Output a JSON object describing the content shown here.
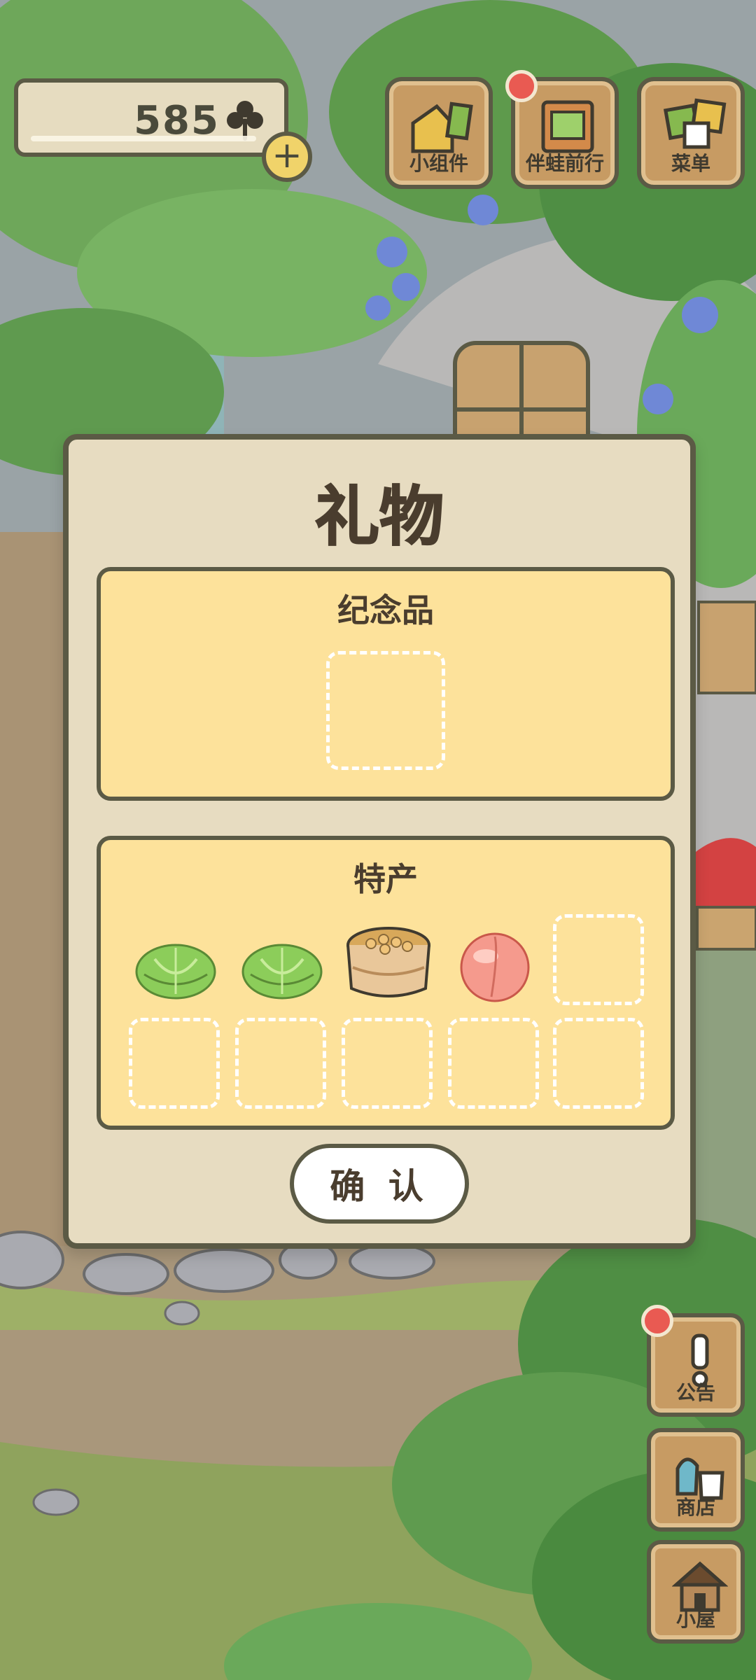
{
  "hud": {
    "clover_count": "585",
    "buttons": [
      {
        "label": "小组件",
        "icon": "widget-icon"
      },
      {
        "label": "伴蛙前行",
        "icon": "album-icon",
        "has_badge": true
      },
      {
        "label": "菜单",
        "icon": "menu-cards-icon"
      }
    ],
    "side": [
      {
        "label": "公告",
        "icon": "exclamation-icon",
        "has_badge": true
      },
      {
        "label": "商店",
        "icon": "shop-bags-icon"
      },
      {
        "label": "小屋",
        "icon": "house-icon"
      }
    ]
  },
  "dialog": {
    "title": "礼物",
    "souvenir_section": {
      "title": "纪念品"
    },
    "specialty_section": {
      "title": "特产",
      "items": [
        "cabbage",
        "cabbage",
        "soybeans-in-tub",
        "peach"
      ]
    },
    "confirm_label": "确 认"
  },
  "colors": {
    "panel_fill": "#fde29b",
    "dialog_fill": "#e7dcc1",
    "outline": "#5b5a45",
    "badge": "#e95a52",
    "wood": "#c79b63"
  }
}
